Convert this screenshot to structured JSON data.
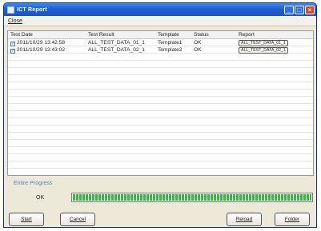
{
  "window": {
    "title": "ICT Report",
    "controls": [
      "_",
      "□",
      "×"
    ]
  },
  "menu": {
    "items": [
      "Close"
    ]
  },
  "table": {
    "columns": [
      "Test Date",
      "Test Result",
      "Template",
      "Status",
      "Report"
    ],
    "rows": [
      {
        "checked": true,
        "date": "2011/10/29 13:42:58",
        "result": "ALL_TEST_DATA_01_1",
        "template": "Template1",
        "status": "OK",
        "report": "ALL_TEST_DATA_01_1"
      },
      {
        "checked": true,
        "date": "2011/10/29 13:43:02",
        "result": "ALL_TEST_DATA_02_1",
        "template": "Template2",
        "status": "OK",
        "report": "ALL_TEST_DATA_02_1"
      }
    ]
  },
  "progress": {
    "label": "Entire Progress",
    "status": "OK",
    "value_percent": 100,
    "fill_color": "#2fbf3a"
  },
  "buttons": {
    "start": "Start",
    "cancel": "Cancel",
    "reload": "Reload",
    "folder": "Folder"
  }
}
